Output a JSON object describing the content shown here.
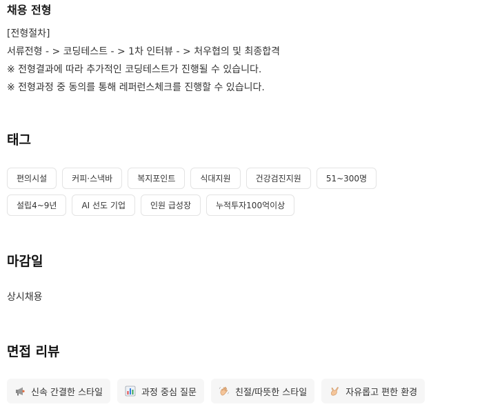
{
  "hiring": {
    "title": "채용 전형",
    "lines": [
      "[전형절차]",
      "서류전형 - >  코딩테스트 - >  1차 인터뷰 - >  처우협의 및 최종합격",
      "※ 전형결과에 따라 추가적인 코딩테스트가 진행될 수 있습니다.",
      "※ 전형과정 중 동의를 통해 레퍼런스체크를 진행할 수 있습니다."
    ]
  },
  "tags": {
    "title": "태그",
    "items": [
      "편의시설",
      "커피·스낵바",
      "복지포인트",
      "식대지원",
      "건강검진지원",
      "51~300명",
      "설립4~9년",
      "AI 선도 기업",
      "인원 급성장",
      "누적투자100억이상"
    ]
  },
  "deadline": {
    "title": "마감일",
    "value": "상시채용"
  },
  "interview_review": {
    "title": "면접 리뷰",
    "items": [
      {
        "icon": "megaphone-icon",
        "label": "신속 간결한 스타일"
      },
      {
        "icon": "bar-chart-icon",
        "label": "과정 중심 질문"
      },
      {
        "icon": "waving-hand-icon",
        "label": "친절/따뜻한 스타일"
      },
      {
        "icon": "call-me-hand-icon",
        "label": "자유롭고 편한 환경"
      }
    ]
  }
}
